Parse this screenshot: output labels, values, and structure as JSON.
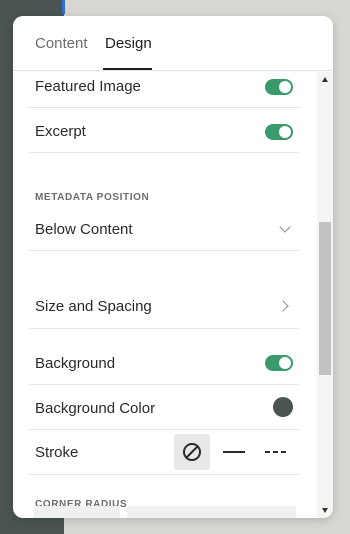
{
  "tabs": [
    {
      "label": "Content",
      "active": false
    },
    {
      "label": "Design",
      "active": true
    }
  ],
  "rows": {
    "featured_image": {
      "label": "Featured Image",
      "toggle_on": true
    },
    "excerpt": {
      "label": "Excerpt",
      "toggle_on": true
    },
    "metadata_position_heading": "METADATA POSITION",
    "metadata_position_value": "Below Content",
    "size_and_spacing": "Size and Spacing",
    "background": {
      "label": "Background",
      "toggle_on": true
    },
    "background_color": {
      "label": "Background Color",
      "color": "#4a5553"
    },
    "stroke": {
      "label": "Stroke",
      "options": [
        "none-icon",
        "solid-line-icon",
        "dashed-line-icon"
      ],
      "selected": "none-icon"
    },
    "corner_radius_heading": "CORNER RADIUS"
  },
  "colors": {
    "toggle_on": "#3a9a6c",
    "backdrop": "#4a5553"
  }
}
